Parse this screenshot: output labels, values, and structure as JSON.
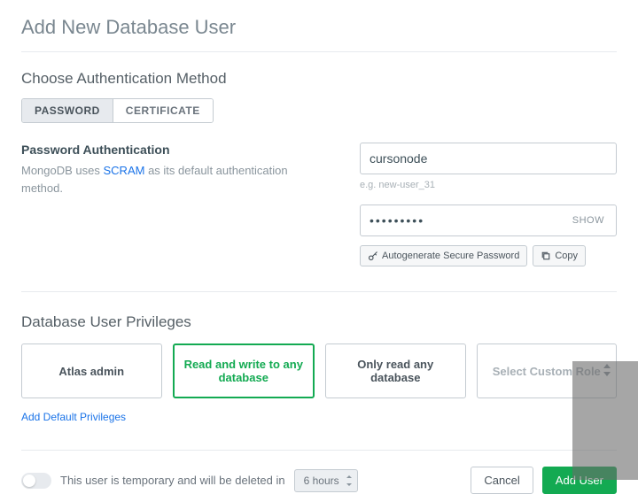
{
  "page_title": "Add New Database User",
  "auth": {
    "section_title": "Choose Authentication Method",
    "tabs": {
      "password": "PASSWORD",
      "certificate": "CERTIFICATE"
    },
    "sub_title": "Password Authentication",
    "desc_prefix": "MongoDB uses ",
    "desc_link": "SCRAM",
    "desc_suffix": " as its default authentication method.",
    "username_value": "cursonode",
    "username_hint": "e.g. new-user_31",
    "password_value": "•••••••••",
    "show_label": "SHOW",
    "autogen_label": "Autogenerate Secure Password",
    "copy_label": "Copy"
  },
  "privileges": {
    "section_title": "Database User Privileges",
    "cards": [
      {
        "label": "Atlas admin"
      },
      {
        "label": "Read and write to any database"
      },
      {
        "label": "Only read any database"
      },
      {
        "label": "Select Custom Role"
      }
    ],
    "add_default": "Add Default Privileges"
  },
  "footer": {
    "temp_text": "This user is temporary and will be deleted in",
    "duration": "6 hours",
    "cancel": "Cancel",
    "submit": "Add User"
  }
}
